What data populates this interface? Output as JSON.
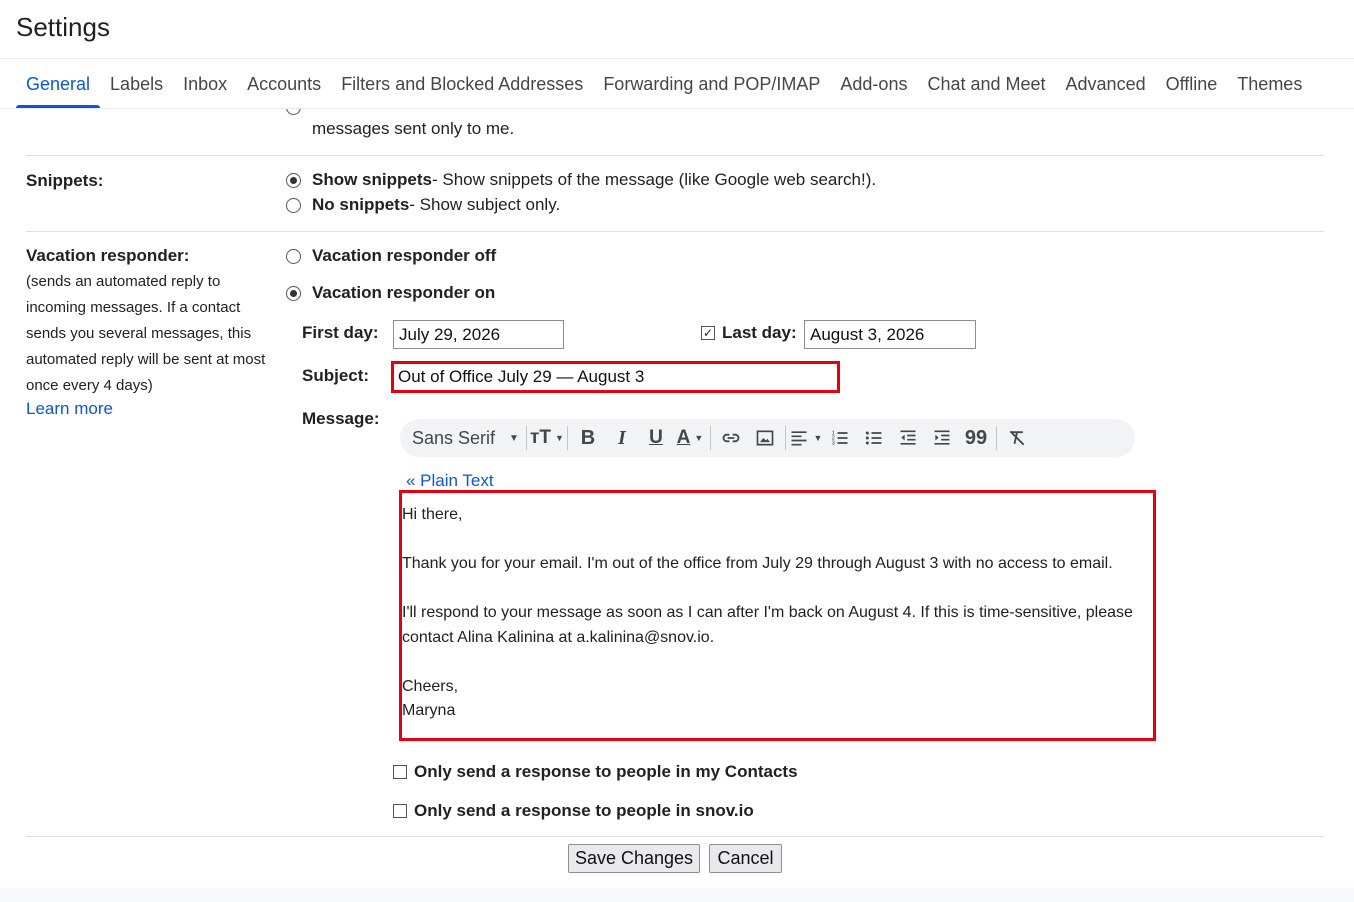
{
  "header": {
    "title": "Settings"
  },
  "tabs": [
    {
      "label": "General",
      "active": true
    },
    {
      "label": "Labels"
    },
    {
      "label": "Inbox"
    },
    {
      "label": "Accounts"
    },
    {
      "label": "Filters and Blocked Addresses"
    },
    {
      "label": "Forwarding and POP/IMAP"
    },
    {
      "label": "Add-ons"
    },
    {
      "label": "Chat and Meet"
    },
    {
      "label": "Advanced"
    },
    {
      "label": "Offline"
    },
    {
      "label": "Themes"
    }
  ],
  "indicators": {
    "partial_text": "messages sent only to me."
  },
  "snippets": {
    "label": "Snippets:",
    "options": [
      {
        "title": "Show snippets",
        "desc": " - Show snippets of the message (like Google web search!).",
        "selected": true
      },
      {
        "title": "No snippets",
        "desc": " - Show subject only.",
        "selected": false
      }
    ]
  },
  "vacation": {
    "label": "Vacation responder:",
    "desc": "(sends an automated reply to incoming messages. If a contact sends you several messages, this automated reply will be sent at most once every 4 days)",
    "learn_more": "Learn more",
    "off_label": "Vacation responder off",
    "on_label": "Vacation responder on",
    "state": "on",
    "first_day_label": "First day:",
    "first_day_value": "July 29, 2026",
    "last_day_label": "Last day:",
    "last_day_checked": true,
    "last_day_value": "August 3, 2026",
    "subject_label": "Subject:",
    "subject_value": "Out of Office July 29 — August 3",
    "message_label": "Message:",
    "font_select": "Sans Serif",
    "plain_text_link": "« Plain Text",
    "message": {
      "greeting": "Hi there,",
      "p1": "Thank you for your email. I'm out of the office from July 29 through August 3 with no access to email.",
      "p2a": "I'll respond to your message as soon as I can after I'm back on August 4. If this is time-sensitive, please",
      "p2b": "contact Alina Kalinina at a.kalinina@snov.io.",
      "closing": "Cheers,",
      "signature": "Maryna"
    },
    "contacts_only_label": "Only send a response to people in my Contacts",
    "contacts_only_checked": false,
    "domain_only_label": "Only send a response to people in snov.io",
    "domain_only_checked": false
  },
  "actions": {
    "save": "Save Changes",
    "cancel": "Cancel"
  },
  "colors": {
    "accent": "#0b57d0",
    "highlight": "#e3000f"
  },
  "toolbar_icons": [
    "font-family-select",
    "text-size-icon",
    "bold-icon",
    "italic-icon",
    "underline-icon",
    "text-color-icon",
    "link-icon",
    "image-icon",
    "align-icon",
    "numbered-list-icon",
    "bulleted-list-icon",
    "indent-less-icon",
    "indent-more-icon",
    "quote-icon",
    "remove-formatting-icon"
  ]
}
